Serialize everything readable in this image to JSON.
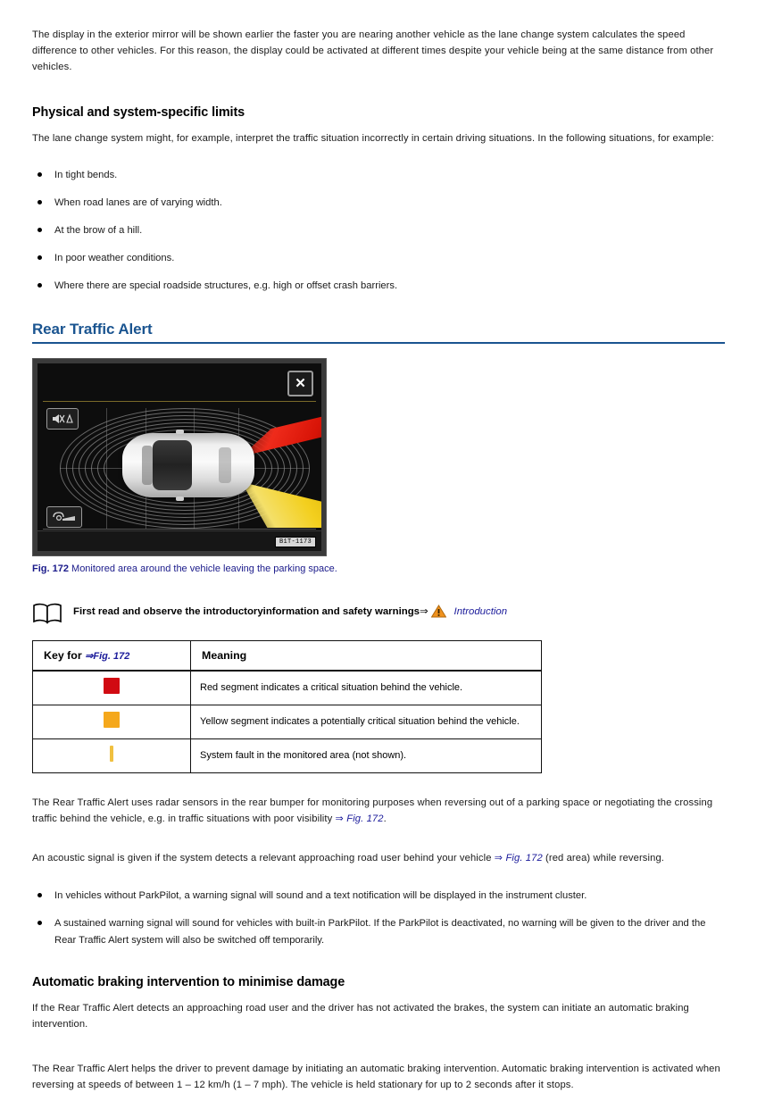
{
  "intro": {
    "paragraph": "The display in the exterior mirror will be shown earlier the faster you are nearing another vehicle as the lane change system calculates the speed difference to other vehicles. For this reason, the display could be activated at different times despite your vehicle being at the same distance from other vehicles."
  },
  "limits": {
    "heading": "Physical and system-specific limits",
    "paragraph": "The lane change system might, for example, interpret the traffic situation incorrectly in certain driving situations. In the following situations, for example:",
    "bullets": [
      "In tight bends.",
      "When road lanes are of varying width.",
      "At the brow of a hill.",
      "In poor weather conditions.",
      "Where there are special roadside structures, e.g. high or offset crash barriers."
    ]
  },
  "rear_traffic_alert": {
    "heading": "Rear Traffic Alert",
    "figure": {
      "image_code": "B1T-1173",
      "close_label": "✕",
      "caption_number": "Fig. 172",
      "caption_text": "Monitored area around the vehicle leaving the parking space.",
      "icons": {
        "speaker": "speaker-mute-icon",
        "towbar": "trailer-towbar-icon"
      },
      "colors": {
        "red_zone": "#e01f10",
        "yellow_zone": "#f2cf20",
        "screen_background": "#0d0d0d",
        "bezel": "#3a3a3a"
      }
    },
    "notice": {
      "text": "First read and observe the introductoryinformation and safety warnings",
      "arrow": "⇒",
      "link": "Introduction"
    },
    "table": {
      "columns": [
        {
          "label_prefix": "Key for",
          "arrow": "⇒",
          "label_ref": "Fig. 172"
        },
        {
          "label": "Meaning"
        }
      ],
      "rows": [
        {
          "swatch": {
            "type": "square",
            "color": "#d10a12",
            "width": 18,
            "height": 18
          },
          "meaning": "Red segment indicates a critical situation behind the vehicle."
        },
        {
          "swatch": {
            "type": "square",
            "color": "#f5a81c",
            "width": 18,
            "height": 18
          },
          "meaning": "Yellow segment indicates a potentially critical situation behind the vehicle."
        },
        {
          "swatch": {
            "type": "bar",
            "color": "#f0c040",
            "width": 4,
            "height": 18
          },
          "meaning": "System fault in the monitored area (not shown)."
        }
      ]
    },
    "paragraph_1_a": "The Rear Traffic Alert uses radar sensors in the rear bumper for monitoring purposes when reversing out of a parking space or negotiating the crossing traffic behind the vehicle, e.g. in traffic situations with poor visibility ",
    "paragraph_1_ref": "Fig. 172",
    "paragraph_1_b": ".",
    "paragraph_2_a": "An acoustic signal is given if the system detects a relevant approaching road user behind your vehicle ",
    "paragraph_2_ref": "Fig. 172",
    "paragraph_2_b": " (red area) while reversing.",
    "bullets": [
      "In vehicles without ParkPilot, a warning signal will sound and a text notification will be displayed in the instrument cluster.",
      "A sustained warning signal will sound for vehicles with built-in ParkPilot. If the ParkPilot is deactivated, no warning will be given to the driver and the Rear Traffic Alert system will also be switched off temporarily."
    ]
  },
  "braking": {
    "heading": "Automatic braking intervention to minimise damage",
    "paragraph_1": "If the Rear Traffic Alert detects an approaching road user and the driver has not activated the brakes, the system can initiate an automatic braking intervention.",
    "paragraph_2": "The Rear Traffic Alert helps the driver to prevent damage by initiating an automatic braking intervention. Automatic braking intervention is activated when reversing at speeds of between 1 – 12 km/h (1 – 7 mph). The vehicle is held stationary for up to 2 seconds after it stops."
  },
  "theme": {
    "heading_color": "#1a5490",
    "link_color": "#1a1a9a",
    "text_color": "#1a1a1a"
  }
}
